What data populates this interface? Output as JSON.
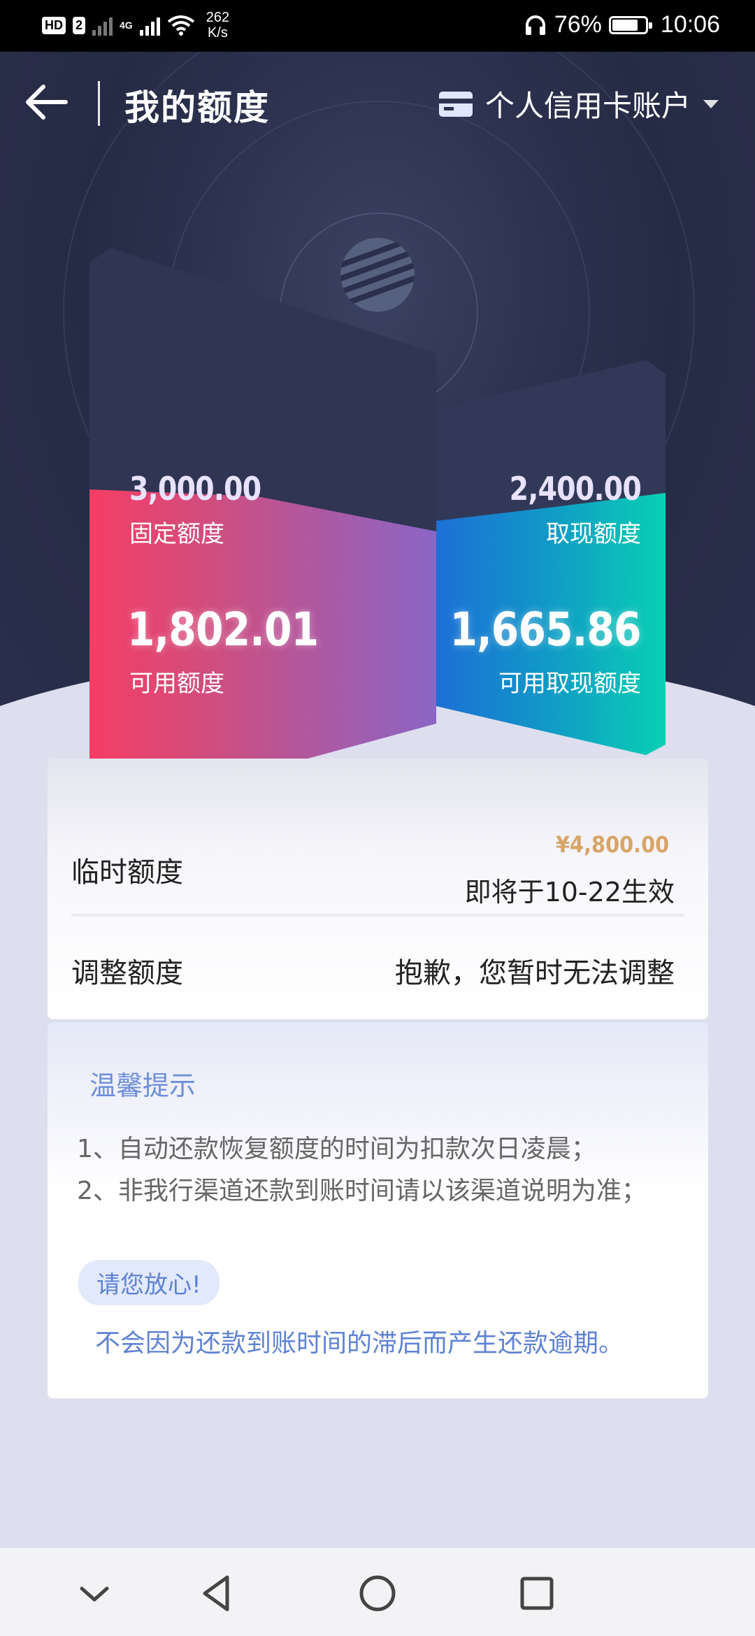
{
  "status_bar": {
    "hd": "HD",
    "sim": "2",
    "net_type": "4G",
    "speed": "262",
    "speed_unit": "K/s",
    "battery": "76%",
    "time": "10:06"
  },
  "header": {
    "title": "我的额度",
    "account": "个人信用卡账户"
  },
  "limits": {
    "fixed_amount": "3,000.00",
    "fixed_label": "固定额度",
    "available_amount": "1,802.01",
    "available_label": "可用额度",
    "cash_amount": "2,400.00",
    "cash_label": "取现额度",
    "available_cash_amount": "1,665.86",
    "available_cash_label": "可用取现额度"
  },
  "temp_limit": {
    "label": "临时额度",
    "amount": "¥4,800.00",
    "effective": "即将于10-22生效"
  },
  "adjust": {
    "label": "调整额度",
    "value": "抱歉，您暂时无法调整"
  },
  "tips": {
    "title": "温馨提示",
    "line1": "1、自动还款恢复额度的时间为扣款次日凌晨；",
    "line2": "2、非我行渠道还款到账时间请以该渠道说明为准；",
    "reassure_badge": "请您放心!",
    "reassure_text": "不会因为还款到账时间的滞后而产生还款逾期。"
  },
  "colors": {
    "hero_bg": "#2a2f4c",
    "left_card_start": "#f53d64",
    "left_card_end": "#8a66c5",
    "right_card_start": "#1d6fd6",
    "right_card_end": "#08d0b3",
    "temp_amount": "#d8a568",
    "tip_blue": "#5f82d4"
  }
}
